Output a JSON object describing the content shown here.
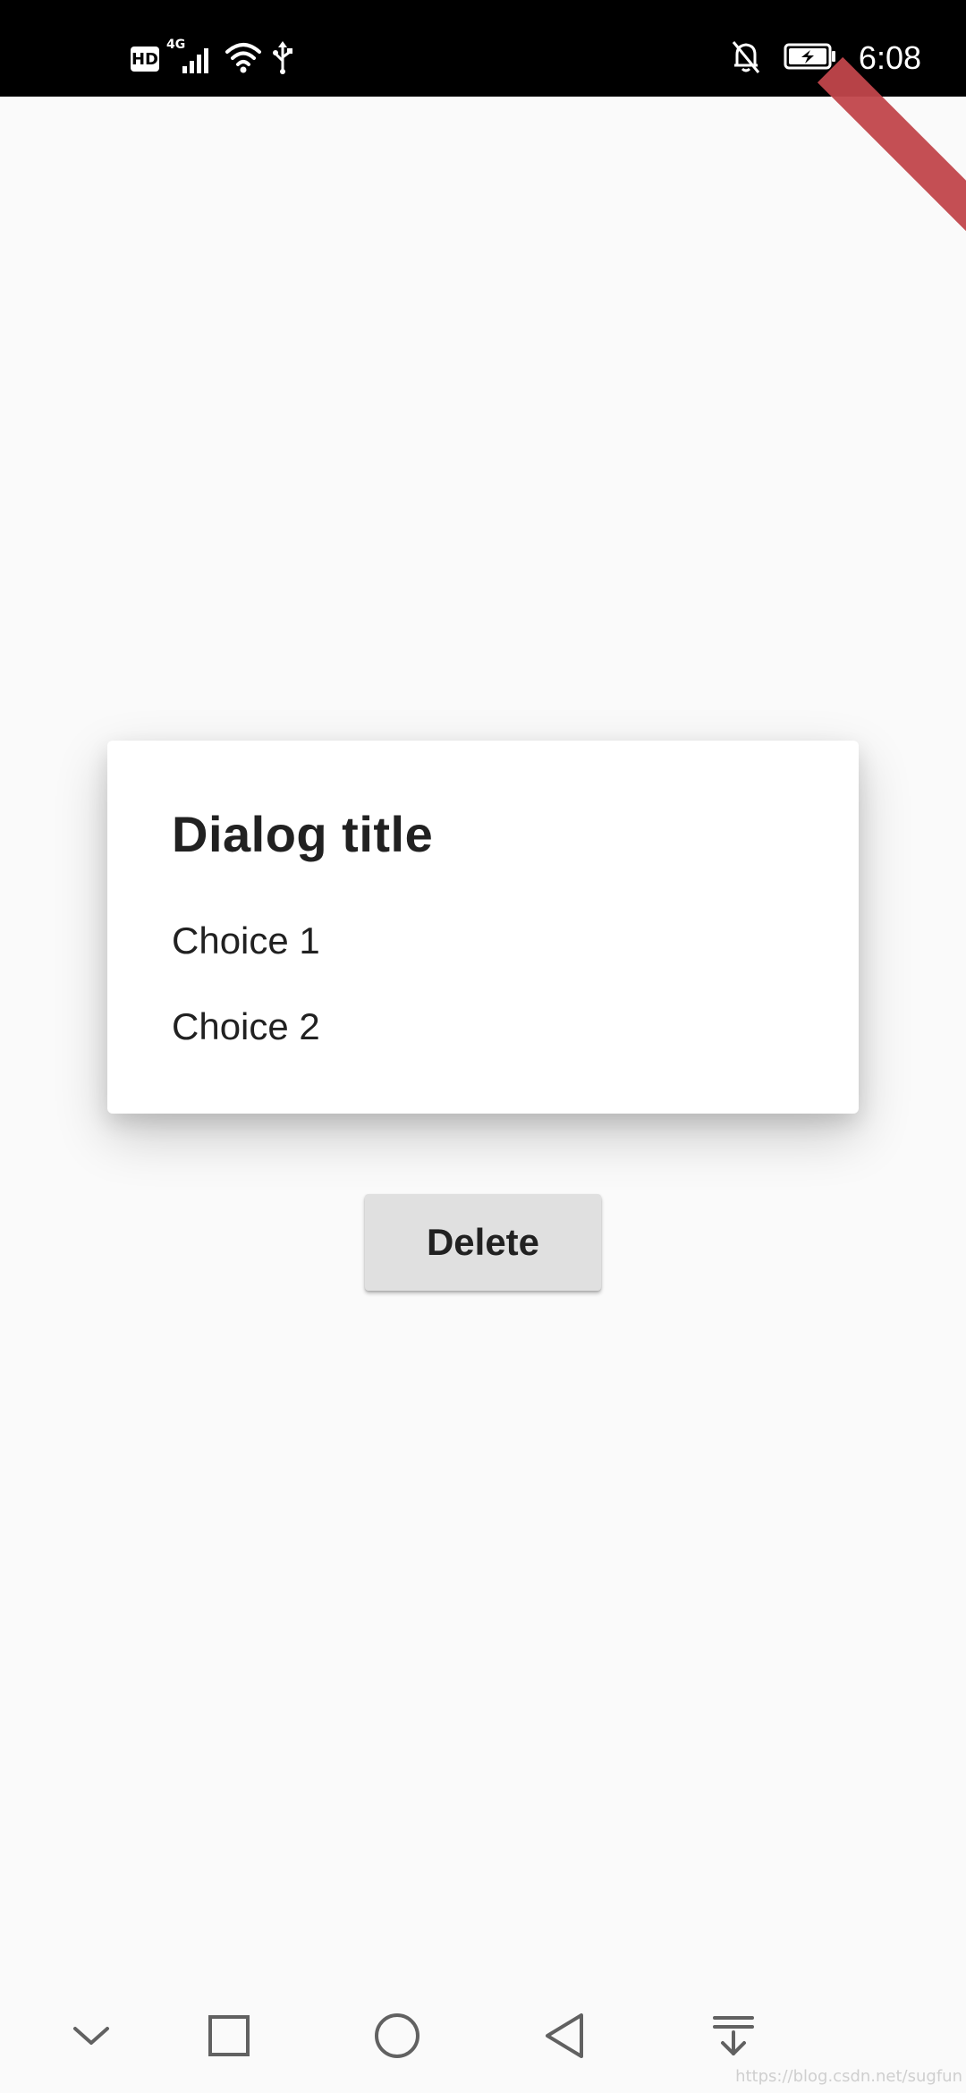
{
  "status_bar": {
    "hd_badge": "HD",
    "network_type": "4G",
    "time": "6:08",
    "icons": [
      "hd-icon",
      "signal-icon",
      "wifi-icon",
      "usb-icon",
      "bell-off-icon",
      "battery-charging-icon"
    ]
  },
  "dialog": {
    "title": "Dialog title",
    "options": [
      {
        "label": "Choice 1"
      },
      {
        "label": "Choice 2"
      }
    ]
  },
  "main": {
    "delete_label": "Delete"
  },
  "nav_bar": {
    "icons": [
      "chevron-down-icon",
      "recents-square-icon",
      "home-circle-icon",
      "back-triangle-icon",
      "notifications-pulldown-icon"
    ]
  },
  "watermark": "https://blog.csdn.net/sugfun",
  "colors": {
    "status_bar_bg": "#000000",
    "background": "#fafafa",
    "dialog_bg": "#ffffff",
    "button_bg": "#e0e0e0",
    "text_primary": "#212121",
    "debug_ribbon": "#c1464b",
    "nav_icon": "#616161"
  }
}
